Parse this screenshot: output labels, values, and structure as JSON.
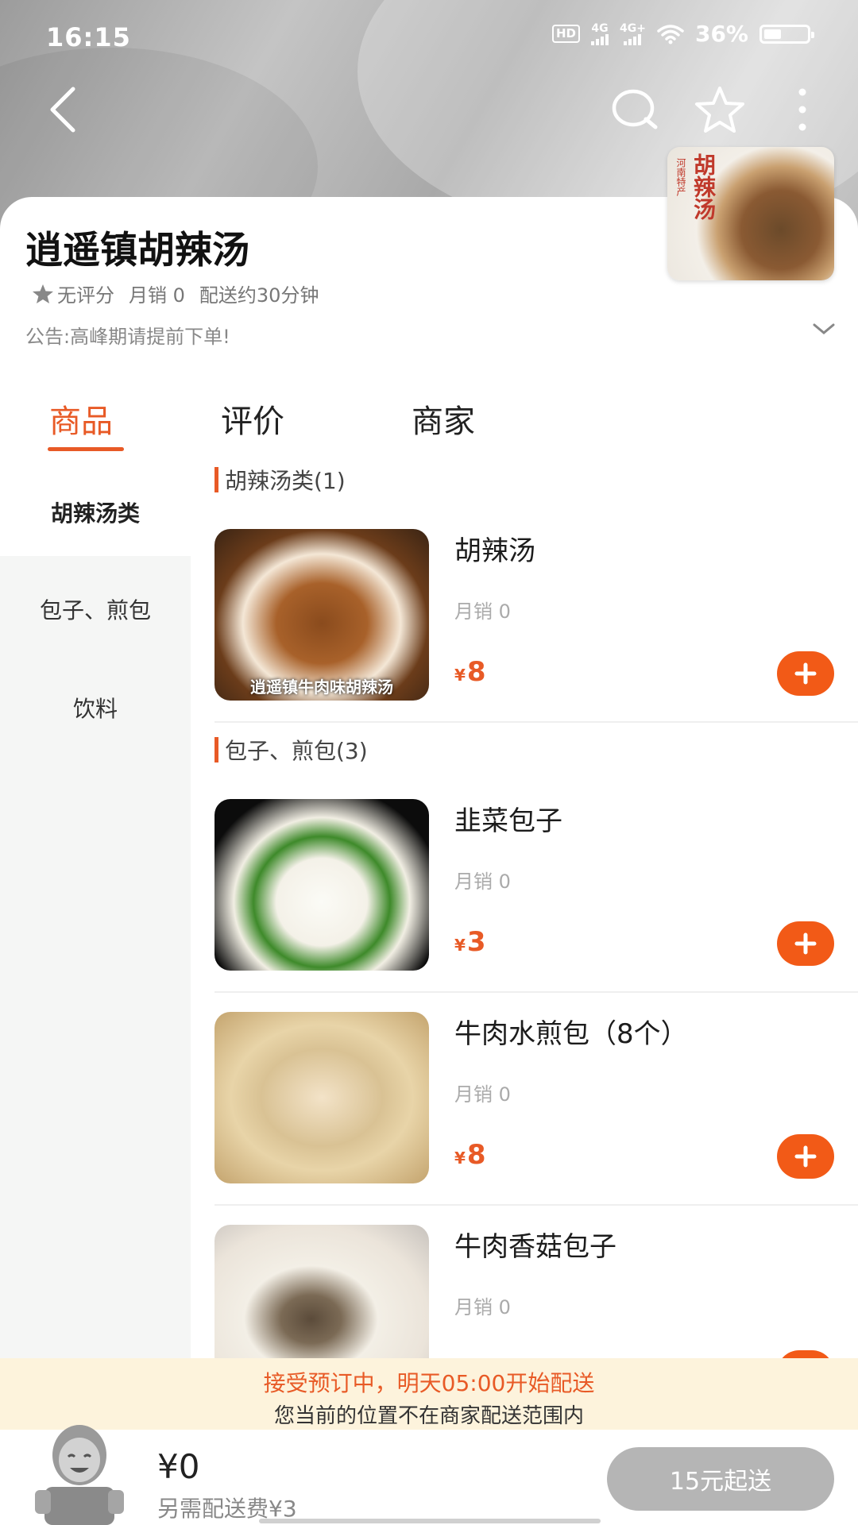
{
  "status_bar": {
    "time": "16:15",
    "hd_label": "HD",
    "net1": "4G",
    "net2": "4G+",
    "battery_text": "36%",
    "battery_level": 0.36
  },
  "header": {
    "back_icon": "chevron-left-icon",
    "search_icon": "search-icon",
    "favorite_icon": "star-outline-icon",
    "more_icon": "more-vertical-icon"
  },
  "shop": {
    "logo_text": "胡辣汤",
    "logo_sub": "河南特产",
    "name": "逍遥镇胡辣汤",
    "rating": "无评分",
    "monthly_sales": "月销 0",
    "delivery_time": "配送约30分钟",
    "notice": "公告:高峰期请提前下单!"
  },
  "tabs": [
    {
      "label": "商品",
      "active": true
    },
    {
      "label": "评价",
      "active": false
    },
    {
      "label": "商家",
      "active": false
    }
  ],
  "sidebar": {
    "items": [
      {
        "label": "胡辣汤类",
        "active": true
      },
      {
        "label": "包子、煎包",
        "active": false
      },
      {
        "label": "饮料",
        "active": false
      }
    ]
  },
  "menu": {
    "sections": [
      {
        "title": "胡辣汤类(1)",
        "items": [
          {
            "name": "胡辣汤",
            "sales": "月销 0",
            "currency": "¥",
            "price": "8",
            "image_caption": "逍遥镇牛肉味胡辣汤"
          }
        ]
      },
      {
        "title": "包子、煎包(3)",
        "items": [
          {
            "name": "韭菜包子",
            "sales": "月销 0",
            "currency": "¥",
            "price": "3"
          },
          {
            "name": "牛肉水煎包（8个）",
            "sales": "月销 0",
            "currency": "¥",
            "price": "8"
          },
          {
            "name": "牛肉香菇包子",
            "sales": "月销 0"
          }
        ]
      }
    ]
  },
  "notice_bar": {
    "line1": "接受预订中，明天05:00开始配送",
    "line2": "您当前的位置不在商家配送范围内"
  },
  "cart": {
    "total": "¥0",
    "delivery_fee": "另需配送费¥3",
    "checkout_label": "15元起送"
  },
  "colors": {
    "accent": "#e85a26",
    "add_button": "#f25a17",
    "notice_bg": "#fdf3dc",
    "checkout_disabled": "#b5b5b5"
  }
}
